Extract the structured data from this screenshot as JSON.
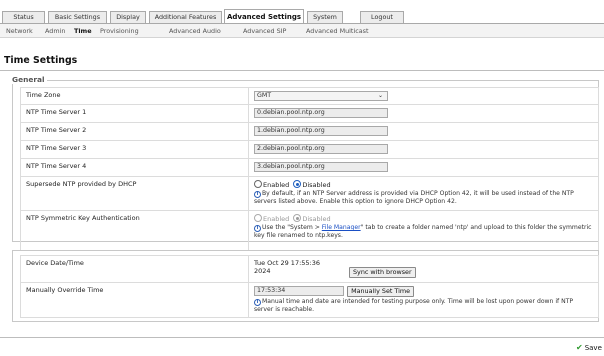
{
  "tabs": [
    {
      "label": "Status"
    },
    {
      "label": "Basic Settings"
    },
    {
      "label": "Display"
    },
    {
      "label": "Additional Features"
    },
    {
      "label": "Advanced Settings",
      "active": true
    },
    {
      "label": "System"
    },
    {
      "label": "Logout"
    }
  ],
  "subnav": [
    {
      "label": "Network"
    },
    {
      "label": "Admin"
    },
    {
      "label": "Time",
      "active": true
    },
    {
      "label": "Provisioning"
    },
    {
      "label": "Advanced Audio"
    },
    {
      "label": "Advanced SIP"
    },
    {
      "label": "Advanced Multicast"
    }
  ],
  "page_title": "Time Settings",
  "general": {
    "legend": "General",
    "time_zone": {
      "label": "Time Zone",
      "value": "GMT"
    },
    "ntp1": {
      "label": "NTP Time Server 1",
      "value": "0.debian.pool.ntp.org"
    },
    "ntp2": {
      "label": "NTP Time Server 2",
      "value": "1.debian.pool.ntp.org"
    },
    "ntp3": {
      "label": "NTP Time Server 3",
      "value": "2.debian.pool.ntp.org"
    },
    "ntp4": {
      "label": "NTP Time Server 4",
      "value": "3.debian.pool.ntp.org"
    },
    "supersede": {
      "label": "Supersede NTP provided by DHCP",
      "enabled": "Enabled",
      "disabled": "Disabled",
      "note": "By default, if an NTP Server address is provided via DHCP Option 42, it will be used instead of the NTP servers listed above. Enable this option to ignore DHCP Option 42."
    },
    "symkey": {
      "label": "NTP Symmetric Key Authentication",
      "enabled": "Enabled",
      "disabled": "Disabled",
      "note_pre": "Use the \"System > ",
      "note_link": "File Manager",
      "note_post": "\" tab to create a folder named 'ntp' and upload to this folder the symmetric key file renamed to ntp.keys."
    }
  },
  "device": {
    "datetime_label": "Device Date/Time",
    "datetime_line1": "Tue Oct 29 17:55:36",
    "datetime_line2": "2024",
    "sync_button": "Sync with browser",
    "override_label": "Manually Override Time",
    "override_value": "17:53:34",
    "set_button": "Manually Set Time",
    "override_note": "Manual time and date are intended for testing purpose only. Time will be lost upon power down if NTP server is reachable."
  },
  "footer": {
    "save": "Save"
  }
}
